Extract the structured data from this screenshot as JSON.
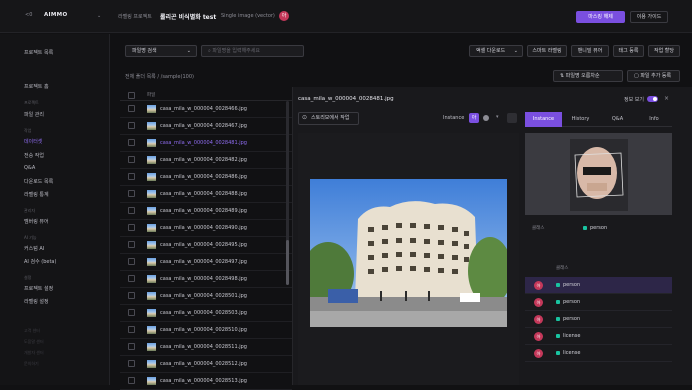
{
  "topbar": {
    "logo_text": "<0",
    "app_name": "AIMMO",
    "crumb_section": "라벨링 프로젝트",
    "project_name": "롤리곤 비식별화 test",
    "project_type": "Single image (vector)",
    "badge": "아",
    "primary_btn": "마스킹 해제",
    "secondary_btn": "이용 가이드"
  },
  "sidebar": {
    "items": [
      {
        "label": "프로젝트 목록",
        "kind": "item"
      },
      {
        "label": "프로젝트 홈",
        "kind": "item"
      },
      {
        "label": "프로젝트",
        "kind": "section"
      },
      {
        "label": "파일 관리",
        "kind": "item"
      },
      {
        "label": "작업",
        "kind": "section"
      },
      {
        "label": "데이터셋",
        "kind": "active"
      },
      {
        "label": "전승 작업",
        "kind": "item"
      },
      {
        "label": "Q&A",
        "kind": "item"
      },
      {
        "label": "다운로드 목록",
        "kind": "item"
      },
      {
        "label": "라벨링 통계",
        "kind": "item"
      },
      {
        "label": "관리자",
        "kind": "section"
      },
      {
        "label": "멤버링 뷰어",
        "kind": "item"
      },
      {
        "label": "AI 기능",
        "kind": "section"
      },
      {
        "label": "커스텀 AI",
        "kind": "item"
      },
      {
        "label": "AI 검수 (beta)",
        "kind": "item"
      },
      {
        "label": "설정",
        "kind": "section"
      },
      {
        "label": "프로젝트 설정",
        "kind": "item"
      },
      {
        "label": "라벨링 설정",
        "kind": "item"
      },
      {
        "label": "고객 센터",
        "kind": "dim"
      },
      {
        "label": "도움말 센터",
        "kind": "dim"
      },
      {
        "label": "개발자 센터",
        "kind": "dim"
      },
      {
        "label": "문의하기",
        "kind": "dim"
      }
    ]
  },
  "filters": {
    "search_mode": "파일명 검색",
    "search_placeholder": "파일명을 입력해주세요",
    "actions": [
      "액셀 다운로드",
      "스마트 라벨링",
      "밴니빌 뷰어",
      "태그 등록",
      "작업 할당"
    ],
    "sort": "파일명 오름차순",
    "add_file": "파일 추가 등록"
  },
  "list": {
    "path": "전체 폴더 목록  /  /sample(100)",
    "header": "파일",
    "files": [
      "casa_mila_w_000004_0028466.jpg",
      "casa_mila_w_000004_0028467.jpg",
      "casa_mila_w_000004_0028481.jpg",
      "casa_mila_w_000004_0028482.jpg",
      "casa_mila_w_000004_0028486.jpg",
      "casa_mila_w_000004_0028488.jpg",
      "casa_mila_w_000004_0028489.jpg",
      "casa_mila_w_000004_0028490.jpg",
      "casa_mila_w_000004_0028495.jpg",
      "casa_mila_w_000004_0028497.jpg",
      "casa_mila_w_000004_0028498.jpg",
      "casa_mila_w_000004_0028501.jpg",
      "casa_mila_w_000004_0028503.jpg",
      "casa_mila_w_000004_0028510.jpg",
      "casa_mila_w_000004_0028511.jpg",
      "casa_mila_w_000004_0028512.jpg",
      "casa_mila_w_000004_0028513.jpg"
    ],
    "selected_index": 2
  },
  "viewer": {
    "filename": "casa_mila_w_000004_0028481.jpg",
    "info_label": "정보 보기",
    "close": "×",
    "story_btn": "스토리모에서 작업",
    "instance_label": "Instance",
    "instance_badge": "아",
    "tabs": [
      "Instance",
      "History",
      "Q&A",
      "Info"
    ],
    "active_tab": 0,
    "class_label": "클래스",
    "class_value": "person",
    "list_header": "클래스",
    "objects": [
      {
        "name": "person",
        "selected": true
      },
      {
        "name": "person",
        "selected": false
      },
      {
        "name": "person",
        "selected": false
      },
      {
        "name": "license",
        "selected": false
      },
      {
        "name": "license",
        "selected": false
      }
    ],
    "badge": "아",
    "class_color": "#19c3a0"
  }
}
